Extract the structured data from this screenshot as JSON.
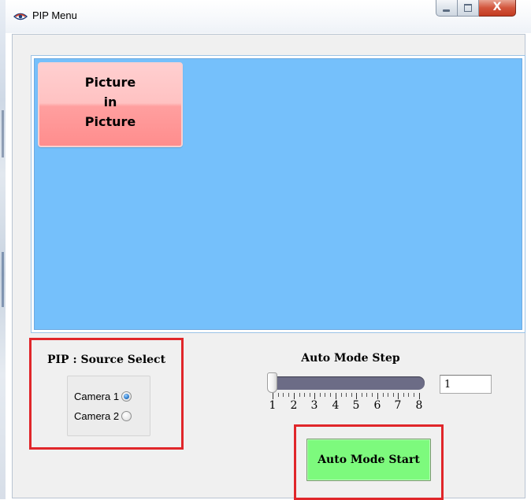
{
  "window": {
    "title": "PIP Menu",
    "close_symbol": "X"
  },
  "preview": {
    "badge_text": "Picture\nin\nPicture",
    "background_color": "#75c0fb"
  },
  "source_select": {
    "title": "PIP : Source Select",
    "options": [
      {
        "label": "Camera 1",
        "selected": true
      },
      {
        "label": "Camera 2",
        "selected": false
      }
    ]
  },
  "auto_mode": {
    "step_title": "Auto Mode Step",
    "slider_value": 1,
    "slider_min": 1,
    "slider_max": 8,
    "tick_labels": [
      "1",
      "2",
      "3",
      "4",
      "5",
      "6",
      "7",
      "8"
    ],
    "step_value_text": "1",
    "start_label": "Auto Mode Start",
    "start_color": "#7dfa7d"
  },
  "icons": {
    "app": "eye-icon",
    "minimize": "minimize-icon",
    "maximize": "maximize-icon",
    "close": "close-icon"
  },
  "colors": {
    "highlight_border": "#e0262a",
    "badge_fill": "#ff9f9f"
  }
}
